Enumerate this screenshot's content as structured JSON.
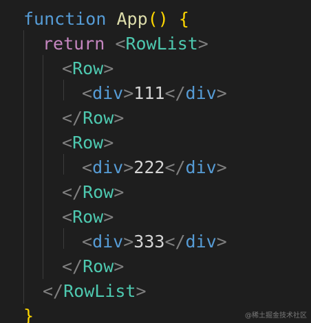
{
  "editor": {
    "lines": [
      {
        "tokens": [
          {
            "text": "function",
            "kind": "kw"
          },
          {
            "text": " ",
            "kind": "text"
          },
          {
            "text": "App",
            "kind": "fn"
          },
          {
            "text": "()",
            "kind": "brace"
          },
          {
            "text": " ",
            "kind": "text"
          },
          {
            "text": "{",
            "kind": "brace"
          }
        ]
      },
      {
        "tokens": [
          {
            "text": "return",
            "kind": "ctrl"
          },
          {
            "text": " ",
            "kind": "text"
          },
          {
            "text": "<",
            "kind": "punc"
          },
          {
            "text": "RowList",
            "kind": "tag"
          },
          {
            "text": ">",
            "kind": "punc"
          }
        ]
      },
      {
        "tokens": [
          {
            "text": "<",
            "kind": "punc"
          },
          {
            "text": "Row",
            "kind": "tag"
          },
          {
            "text": ">",
            "kind": "punc"
          }
        ]
      },
      {
        "tokens": [
          {
            "text": "<",
            "kind": "punc"
          },
          {
            "text": "div",
            "kind": "html-tag"
          },
          {
            "text": ">",
            "kind": "punc"
          },
          {
            "text": "111",
            "kind": "text"
          },
          {
            "text": "</",
            "kind": "punc"
          },
          {
            "text": "div",
            "kind": "html-tag"
          },
          {
            "text": ">",
            "kind": "punc"
          }
        ]
      },
      {
        "tokens": [
          {
            "text": "</",
            "kind": "punc"
          },
          {
            "text": "Row",
            "kind": "tag"
          },
          {
            "text": ">",
            "kind": "punc"
          }
        ]
      },
      {
        "tokens": [
          {
            "text": "<",
            "kind": "punc"
          },
          {
            "text": "Row",
            "kind": "tag"
          },
          {
            "text": ">",
            "kind": "punc"
          }
        ]
      },
      {
        "tokens": [
          {
            "text": "<",
            "kind": "punc"
          },
          {
            "text": "div",
            "kind": "html-tag"
          },
          {
            "text": ">",
            "kind": "punc"
          },
          {
            "text": "222",
            "kind": "text"
          },
          {
            "text": "</",
            "kind": "punc"
          },
          {
            "text": "div",
            "kind": "html-tag"
          },
          {
            "text": ">",
            "kind": "punc"
          }
        ]
      },
      {
        "tokens": [
          {
            "text": "</",
            "kind": "punc"
          },
          {
            "text": "Row",
            "kind": "tag"
          },
          {
            "text": ">",
            "kind": "punc"
          }
        ]
      },
      {
        "tokens": [
          {
            "text": "<",
            "kind": "punc"
          },
          {
            "text": "Row",
            "kind": "tag"
          },
          {
            "text": ">",
            "kind": "punc"
          }
        ]
      },
      {
        "tokens": [
          {
            "text": "<",
            "kind": "punc"
          },
          {
            "text": "div",
            "kind": "html-tag"
          },
          {
            "text": ">",
            "kind": "punc"
          },
          {
            "text": "333",
            "kind": "text"
          },
          {
            "text": "</",
            "kind": "punc"
          },
          {
            "text": "div",
            "kind": "html-tag"
          },
          {
            "text": ">",
            "kind": "punc"
          }
        ]
      },
      {
        "tokens": [
          {
            "text": "</",
            "kind": "punc"
          },
          {
            "text": "Row",
            "kind": "tag"
          },
          {
            "text": ">",
            "kind": "punc"
          }
        ]
      },
      {
        "tokens": [
          {
            "text": "</",
            "kind": "punc"
          },
          {
            "text": "RowList",
            "kind": "tag"
          },
          {
            "text": ">",
            "kind": "punc"
          }
        ]
      },
      {
        "tokens": [
          {
            "text": "}",
            "kind": "brace"
          }
        ]
      }
    ]
  },
  "colors": {
    "background": "#1e1e1e",
    "keyword": "#569cd6",
    "control": "#c586c0",
    "function": "#dcdcaa",
    "brace": "#ffd700",
    "component_tag": "#4ec9b0",
    "html_tag": "#569cd6",
    "punctuation": "#808080",
    "text": "#d4d4d4"
  },
  "watermark": "@稀土掘金技术社区"
}
